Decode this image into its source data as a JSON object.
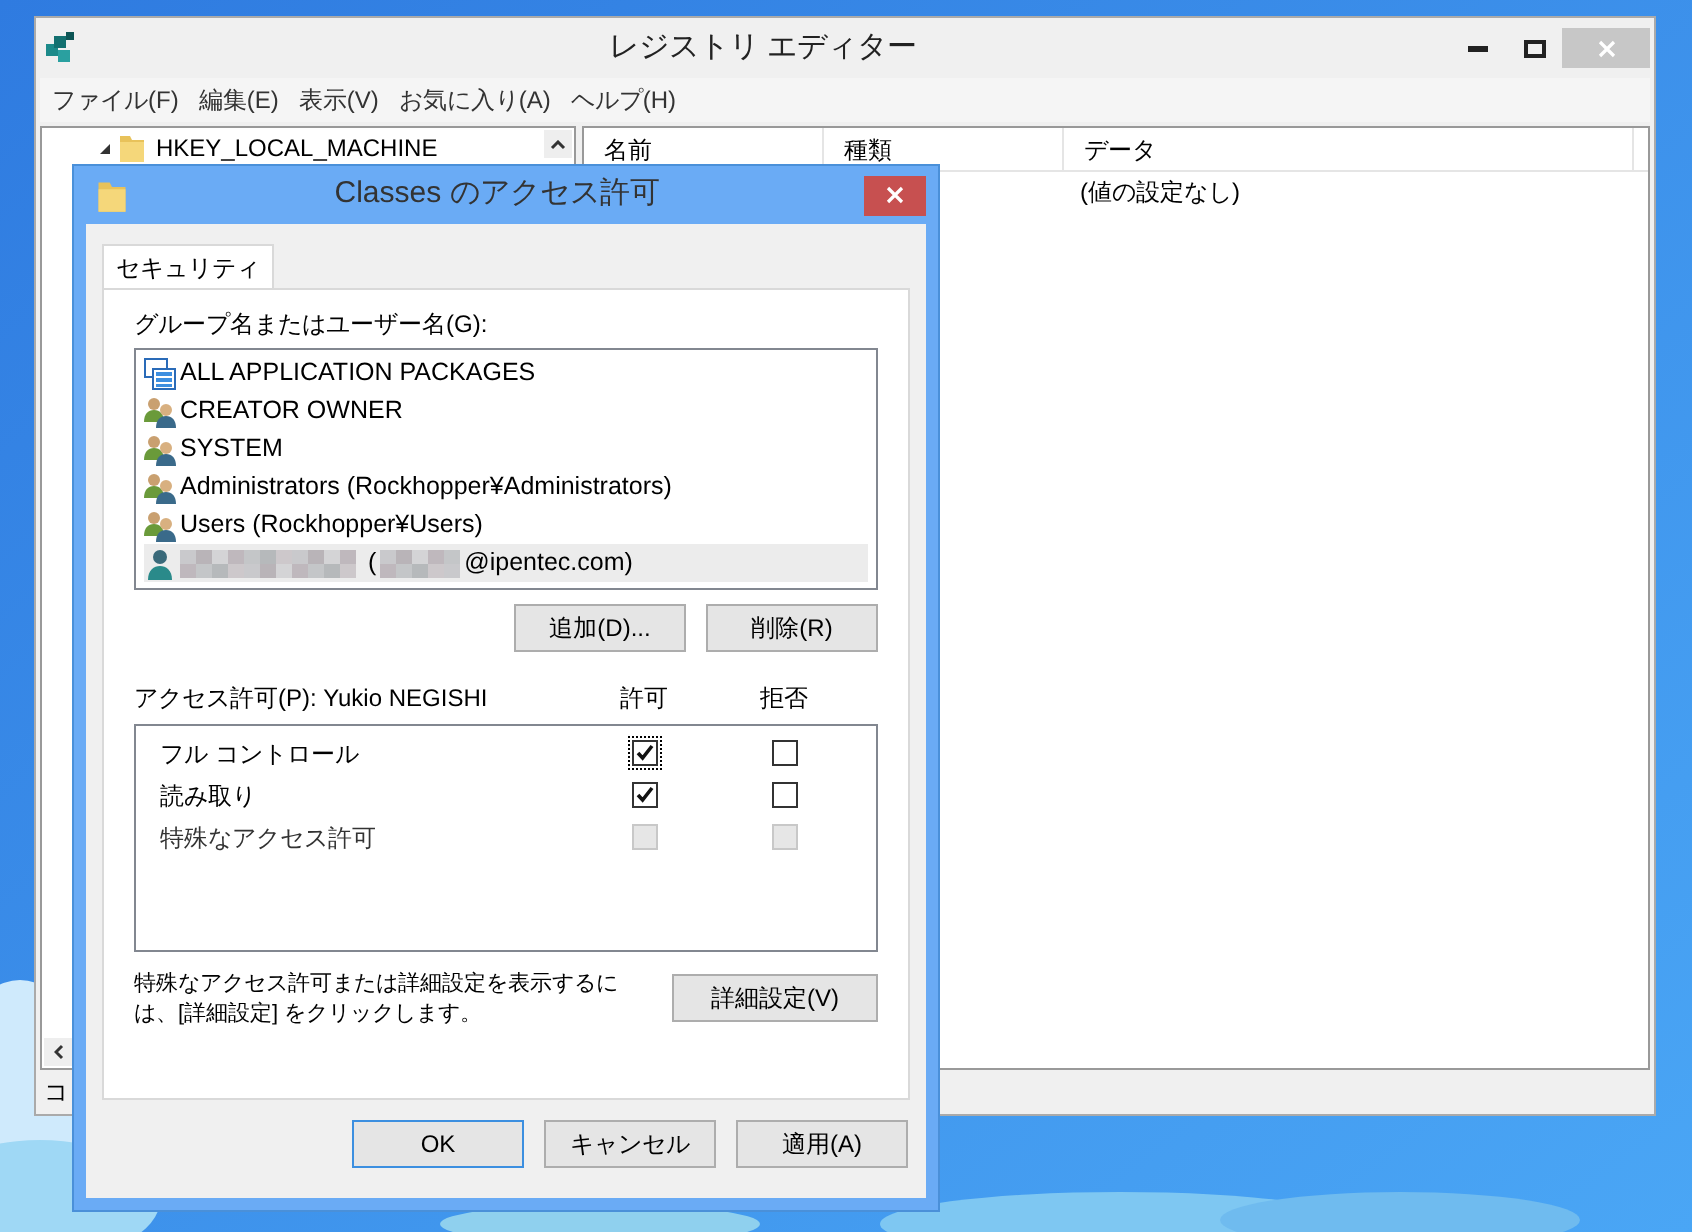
{
  "registry_window": {
    "title": "レジストリ エディター",
    "menu": [
      "ファイル(F)",
      "編集(E)",
      "表示(V)",
      "お気に入り(A)",
      "ヘルプ(H)"
    ],
    "tree": {
      "items": [
        {
          "label": "HKEY_LOCAL_MACHINE",
          "expanded": true
        }
      ]
    },
    "list": {
      "columns": [
        "名前",
        "種類",
        "データ"
      ],
      "rows": [
        {
          "column_1": "",
          "column_2": "",
          "data": "(値の設定なし)"
        }
      ]
    },
    "status_bar": "コ"
  },
  "dialog": {
    "title": "Classes のアクセス許可",
    "tabs": [
      {
        "label": "セキュリティ",
        "selected": true
      }
    ],
    "principals_label": "グループ名またはユーザー名(G):",
    "principals": [
      {
        "kind": "package",
        "name": "ALL APPLICATION PACKAGES",
        "selected": false
      },
      {
        "kind": "group",
        "name": "CREATOR OWNER",
        "selected": false
      },
      {
        "kind": "group",
        "name": "SYSTEM",
        "selected": false
      },
      {
        "kind": "group",
        "name": "Administrators (Rockhopper¥Administrators)",
        "selected": false
      },
      {
        "kind": "group",
        "name": "Users (Rockhopper¥Users)",
        "selected": false
      },
      {
        "kind": "user",
        "name_open": "(",
        "name": "@ipentec.com)",
        "selected": true
      }
    ],
    "principal_buttons": [
      "追加(D)...",
      "削除(R)"
    ],
    "permissions_label": "アクセス許可(P): Yukio NEGISHI",
    "permission_columns": [
      "許可",
      "拒否"
    ],
    "permissions": [
      {
        "label": "フル コントロール",
        "allow": {
          "checked": true,
          "disabled": false,
          "focused": true
        },
        "deny": {
          "checked": false,
          "disabled": false,
          "focused": false
        }
      },
      {
        "label": "読み取り",
        "allow": {
          "checked": true,
          "disabled": false,
          "focused": false
        },
        "deny": {
          "checked": false,
          "disabled": false,
          "focused": false
        }
      },
      {
        "label": "特殊なアクセス許可",
        "allow": {
          "checked": false,
          "disabled": true,
          "focused": false
        },
        "deny": {
          "checked": false,
          "disabled": true,
          "focused": false
        }
      }
    ],
    "advanced_hint": "特殊なアクセス許可または詳細設定を表示するには、[詳細設定] をクリックします。",
    "advanced_button": "詳細設定(V)",
    "buttons": [
      {
        "label": "OK",
        "default": true
      },
      {
        "label": "キャンセル",
        "default": false
      },
      {
        "label": "適用(A)",
        "default": false
      }
    ]
  }
}
